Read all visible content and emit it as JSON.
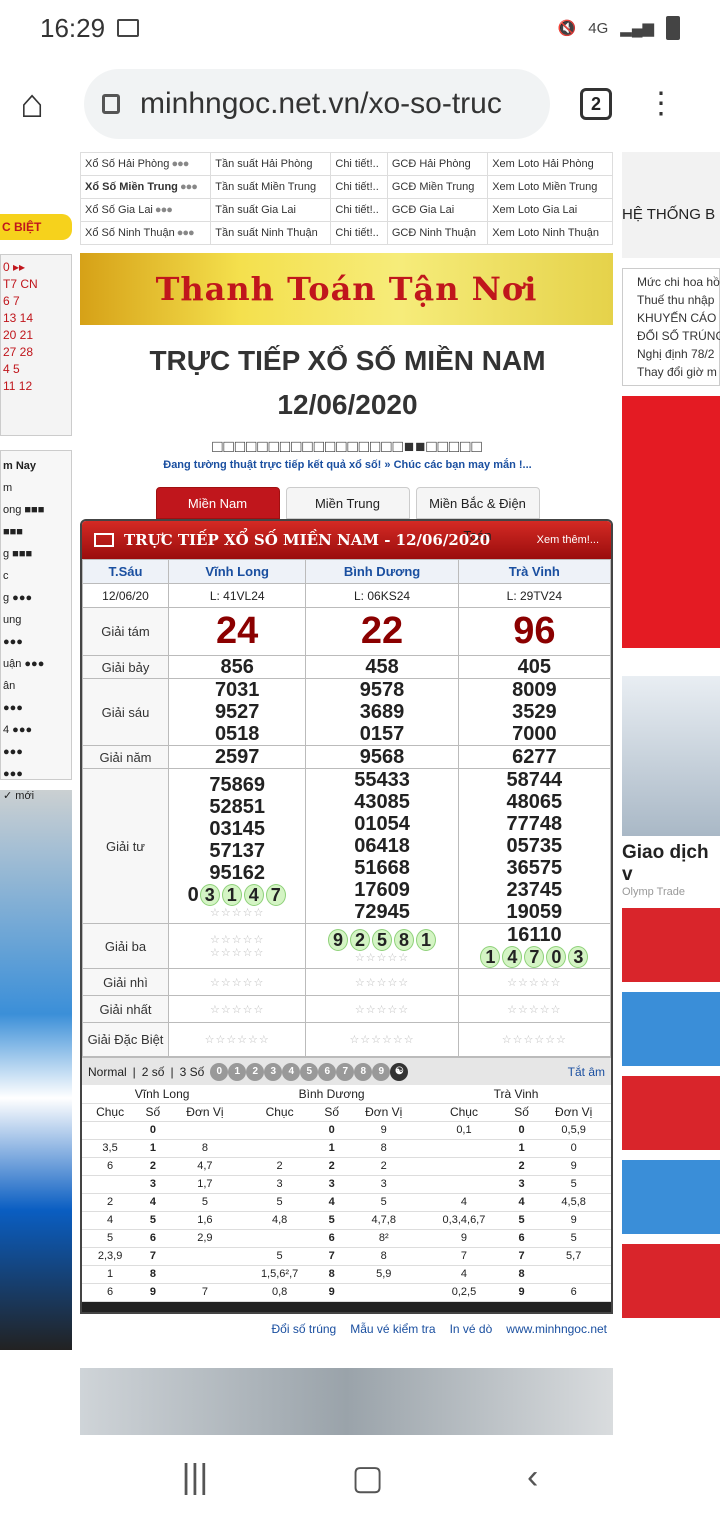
{
  "status": {
    "time": "16:29",
    "network": "4G"
  },
  "browser": {
    "url": "minhngoc.net.vn/xo-so-truc",
    "tab_count": "2"
  },
  "links": [
    {
      "name": "Xổ Số Hải Phòng",
      "freq": "Tần suất Hải Phòng",
      "detail": "Chi tiết!..",
      "gcd": "GCĐ Hải Phòng",
      "loto": "Xem Loto Hải Phòng"
    },
    {
      "name": "Xổ Số Miền Trung",
      "freq": "Tần suất Miền Trung",
      "detail": "Chi tiết!..",
      "gcd": "GCĐ Miền Trung",
      "loto": "Xem Loto Miền Trung"
    },
    {
      "name": "Xổ Số Gia Lai",
      "freq": "Tần suất Gia Lai",
      "detail": "Chi tiết!..",
      "gcd": "GCĐ Gia Lai",
      "loto": "Xem Loto Gia Lai"
    },
    {
      "name": "Xổ Số Ninh Thuận",
      "freq": "Tần suất Ninh Thuận",
      "detail": "Chi tiết!..",
      "gcd": "GCĐ Ninh Thuận",
      "loto": "Xem Loto Ninh Thuận"
    }
  ],
  "banner_text": "Thanh Toán Tận Nơi",
  "title1": "TRỰC TIẾP XỔ SỐ MIỀN NAM",
  "title2": "12/06/2020",
  "boxes": "□□□□□□□□□□□□□□□□□■■□□□□□",
  "marquee": "Đang tường thuật trực tiếp kết quả xổ số! » Chúc các bạn may mắn !...",
  "region_tabs": [
    "Miền Nam",
    "Miền Trung",
    "Miền Bắc & Điện Toán"
  ],
  "result_header": "TRỰC TIẾP XỔ SỐ MIỀN NAM - 12/06/2020",
  "see_more": "Xem thêm!...",
  "day": "T.Sáu",
  "date": "12/06/20",
  "provinces": [
    "Vĩnh Long",
    "Bình Dương",
    "Trà Vinh"
  ],
  "codes": [
    "L: 41VL24",
    "L: 06KS24",
    "L: 29TV24"
  ],
  "labels": {
    "g8": "Giải tám",
    "g7": "Giải bảy",
    "g6": "Giải sáu",
    "g5": "Giải năm",
    "g4": "Giải tư",
    "g3": "Giải ba",
    "g2": "Giải nhì",
    "g1": "Giải nhất",
    "db": "Giải Đặc Biệt"
  },
  "g8": [
    "24",
    "22",
    "96"
  ],
  "g7": [
    "856",
    "458",
    "405"
  ],
  "g6": [
    [
      "7031",
      "9527",
      "0518"
    ],
    [
      "9578",
      "3689",
      "0157"
    ],
    [
      "8009",
      "3529",
      "7000"
    ]
  ],
  "g5": [
    "2597",
    "9568",
    "6277"
  ],
  "g4": [
    [
      "75869",
      "52851",
      "03145",
      "57137",
      "95162",
      "03147"
    ],
    [
      "55433",
      "43085",
      "01054",
      "06418",
      "51668",
      "17609",
      "72945"
    ],
    [
      "58744",
      "48065",
      "77748",
      "05735",
      "36575",
      "23745",
      "19059"
    ]
  ],
  "g3": [
    [
      "",
      ""
    ],
    [
      "92581",
      ""
    ],
    [
      "16110",
      "14703"
    ]
  ],
  "toolbar": {
    "normal": "Normal",
    "two": "2 số",
    "three": "3 Số",
    "mute": "Tắt âm"
  },
  "loto_head": {
    "chuc": "Chục",
    "so": "Số",
    "dv": "Đơn Vị"
  },
  "loto": [
    [
      [
        "",
        "0",
        ""
      ],
      [
        "",
        "0",
        "9"
      ],
      [
        "0,1",
        "0",
        "0,5,9"
      ]
    ],
    [
      [
        "3,5",
        "1",
        "8"
      ],
      [
        "",
        "1",
        "8"
      ],
      [
        "",
        "1",
        "0"
      ]
    ],
    [
      [
        "6",
        "2",
        "4,7"
      ],
      [
        "2",
        "2",
        "2"
      ],
      [
        "",
        "2",
        "9"
      ]
    ],
    [
      [
        "",
        "3",
        "1,7"
      ],
      [
        "3",
        "3",
        "3"
      ],
      [
        "",
        "3",
        "5"
      ]
    ],
    [
      [
        "2",
        "4",
        "5"
      ],
      [
        "5",
        "4",
        "5"
      ],
      [
        "4",
        "4",
        "4,5,8"
      ]
    ],
    [
      [
        "4",
        "5",
        "1,6"
      ],
      [
        "4,8",
        "5",
        "4,7,8"
      ],
      [
        "0,3,4,6,7",
        "5",
        "9"
      ]
    ],
    [
      [
        "5",
        "6",
        "2,9"
      ],
      [
        "",
        "6",
        "8²"
      ],
      [
        "9",
        "6",
        "5"
      ]
    ],
    [
      [
        "2,3,9",
        "7",
        ""
      ],
      [
        "5",
        "7",
        "8"
      ],
      [
        "7",
        "7",
        "5,7"
      ]
    ],
    [
      [
        "1",
        "8",
        ""
      ],
      [
        "1,5,6²,7",
        "8",
        "5,9"
      ],
      [
        "4",
        "8",
        ""
      ]
    ],
    [
      [
        "6",
        "9",
        "7"
      ],
      [
        "0,8",
        "9",
        ""
      ],
      [
        "0,2,5",
        "9",
        "6"
      ]
    ]
  ],
  "footer": {
    "l1": "Đổi số trúng",
    "l2": "Mẫu vé kiểm tra",
    "l3": "In vé dò",
    "l4": "www.minhngoc.net"
  },
  "right": {
    "heading": "HỆ THỐNG B",
    "items": [
      "Mức chi hoa hồ",
      "Thuế thu nhập",
      "KHUYẾN CÁO K",
      "ĐỔI SỐ TRÚNG",
      "Nghị định 78/2",
      "Thay đổi giờ m"
    ],
    "olymp": "Giao dịch v",
    "olymp_src": "Olymp Trade"
  },
  "left": {
    "special": "C BIỆT",
    "today": "m Nay",
    "moi": "mới"
  }
}
